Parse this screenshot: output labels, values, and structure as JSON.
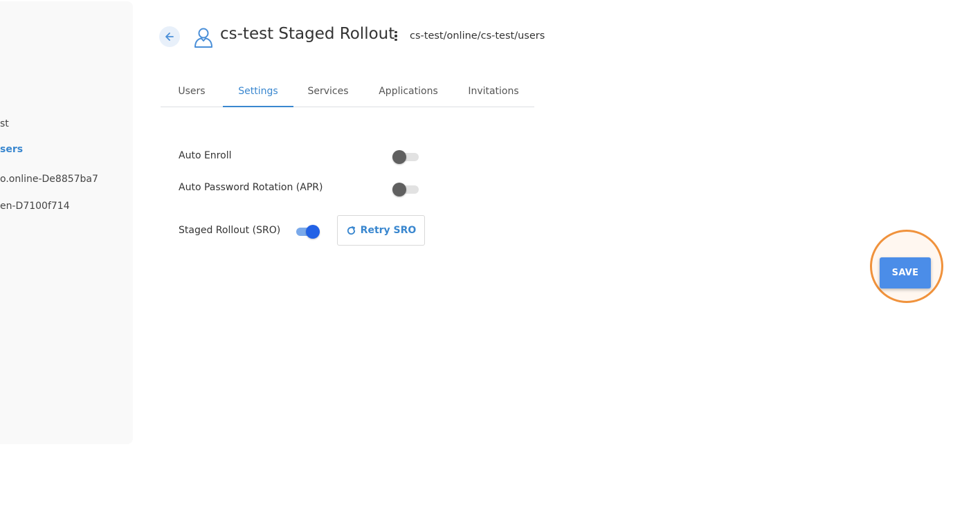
{
  "sidebar": {
    "items": [
      {
        "label": "st",
        "active": false
      },
      {
        "label": "sers",
        "active": true
      },
      {
        "label": "o.online-De8857ba7",
        "active": false
      },
      {
        "label": "en-D7100f714",
        "active": false
      }
    ]
  },
  "header": {
    "back_icon": "arrow-left-icon",
    "group_icon": "user-outline-icon",
    "title": "cs-test Staged Rollout",
    "menu_icon": "kebab-menu-icon",
    "breadcrumb": "cs-test/online/cs-test/users"
  },
  "tabs": [
    {
      "label": "Users",
      "active": false
    },
    {
      "label": "Settings",
      "active": true
    },
    {
      "label": "Services",
      "active": false
    },
    {
      "label": "Applications",
      "active": false
    },
    {
      "label": "Invitations",
      "active": false
    }
  ],
  "settings": {
    "auto_enroll": {
      "label": "Auto Enroll",
      "enabled": false
    },
    "auto_password_rotation": {
      "label": "Auto Password Rotation (APR)",
      "enabled": false
    },
    "staged_rollout": {
      "label": "Staged Rollout (SRO)",
      "enabled": true
    },
    "retry_button": {
      "label": "Retry SRO",
      "icon": "refresh-icon"
    }
  },
  "actions": {
    "save_label": "SAVE"
  },
  "colors": {
    "accent": "#3a87cf",
    "toggle_on": "#2262e6",
    "save_button": "#4b8de8",
    "highlight_ring": "#f0923c"
  }
}
